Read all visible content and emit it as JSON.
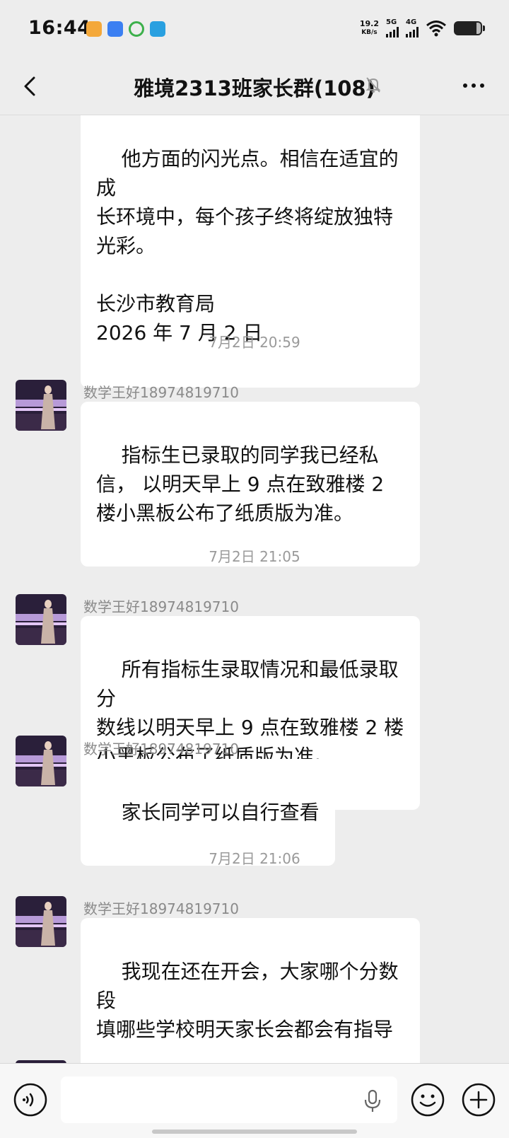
{
  "status_bar": {
    "time": "16:44",
    "net_speed_value": "19.2",
    "net_speed_unit": "KB/s",
    "signal_1": "5G",
    "signal_2": "4G",
    "icons": [
      "taobao-icon",
      "blue-app-icon",
      "green-sync-icon",
      "blue-square-app-icon",
      "wifi-icon",
      "battery-icon"
    ]
  },
  "header": {
    "title": "雅境2313班家长群(108)",
    "icons": [
      "back-icon",
      "mute-bell-icon",
      "more-icon"
    ]
  },
  "messages": [
    {
      "type": "text",
      "text": "他方面的闪光点。相信在适宜的成\n长环境中，每个孩子终将绽放独特\n光彩。\n\n长沙市教育局\n2026 年 7 月 2 日"
    },
    {
      "type": "time",
      "text": "7月2日 20:59"
    },
    {
      "type": "text",
      "sender": "数学王好18974819710",
      "text": "指标生已录取的同学我已经私\n信， 以明天早上 9 点在致雅楼 2\n楼小黑板公布了纸质版为准。"
    },
    {
      "type": "time",
      "text": "7月2日 21:05"
    },
    {
      "type": "text",
      "sender": "数学王好18974819710",
      "text": "所有指标生录取情况和最低录取分\n数线以明天早上 9 点在致雅楼 2 楼\n小黑板公布了纸质版为准。"
    },
    {
      "type": "text",
      "sender": "数学王好18974819710",
      "text": "家长同学可以自行查看"
    },
    {
      "type": "time",
      "text": "7月2日 21:06"
    },
    {
      "type": "text",
      "sender": "数学王好18974819710",
      "text": "我现在还在开会，大家哪个分数段\n填哪些学校明天家长会都会有指导",
      "emoji": "🙏"
    }
  ],
  "input_bar": {
    "icons": [
      "voice-icon",
      "microphone-icon",
      "emoji-icon",
      "plus-icon"
    ]
  }
}
